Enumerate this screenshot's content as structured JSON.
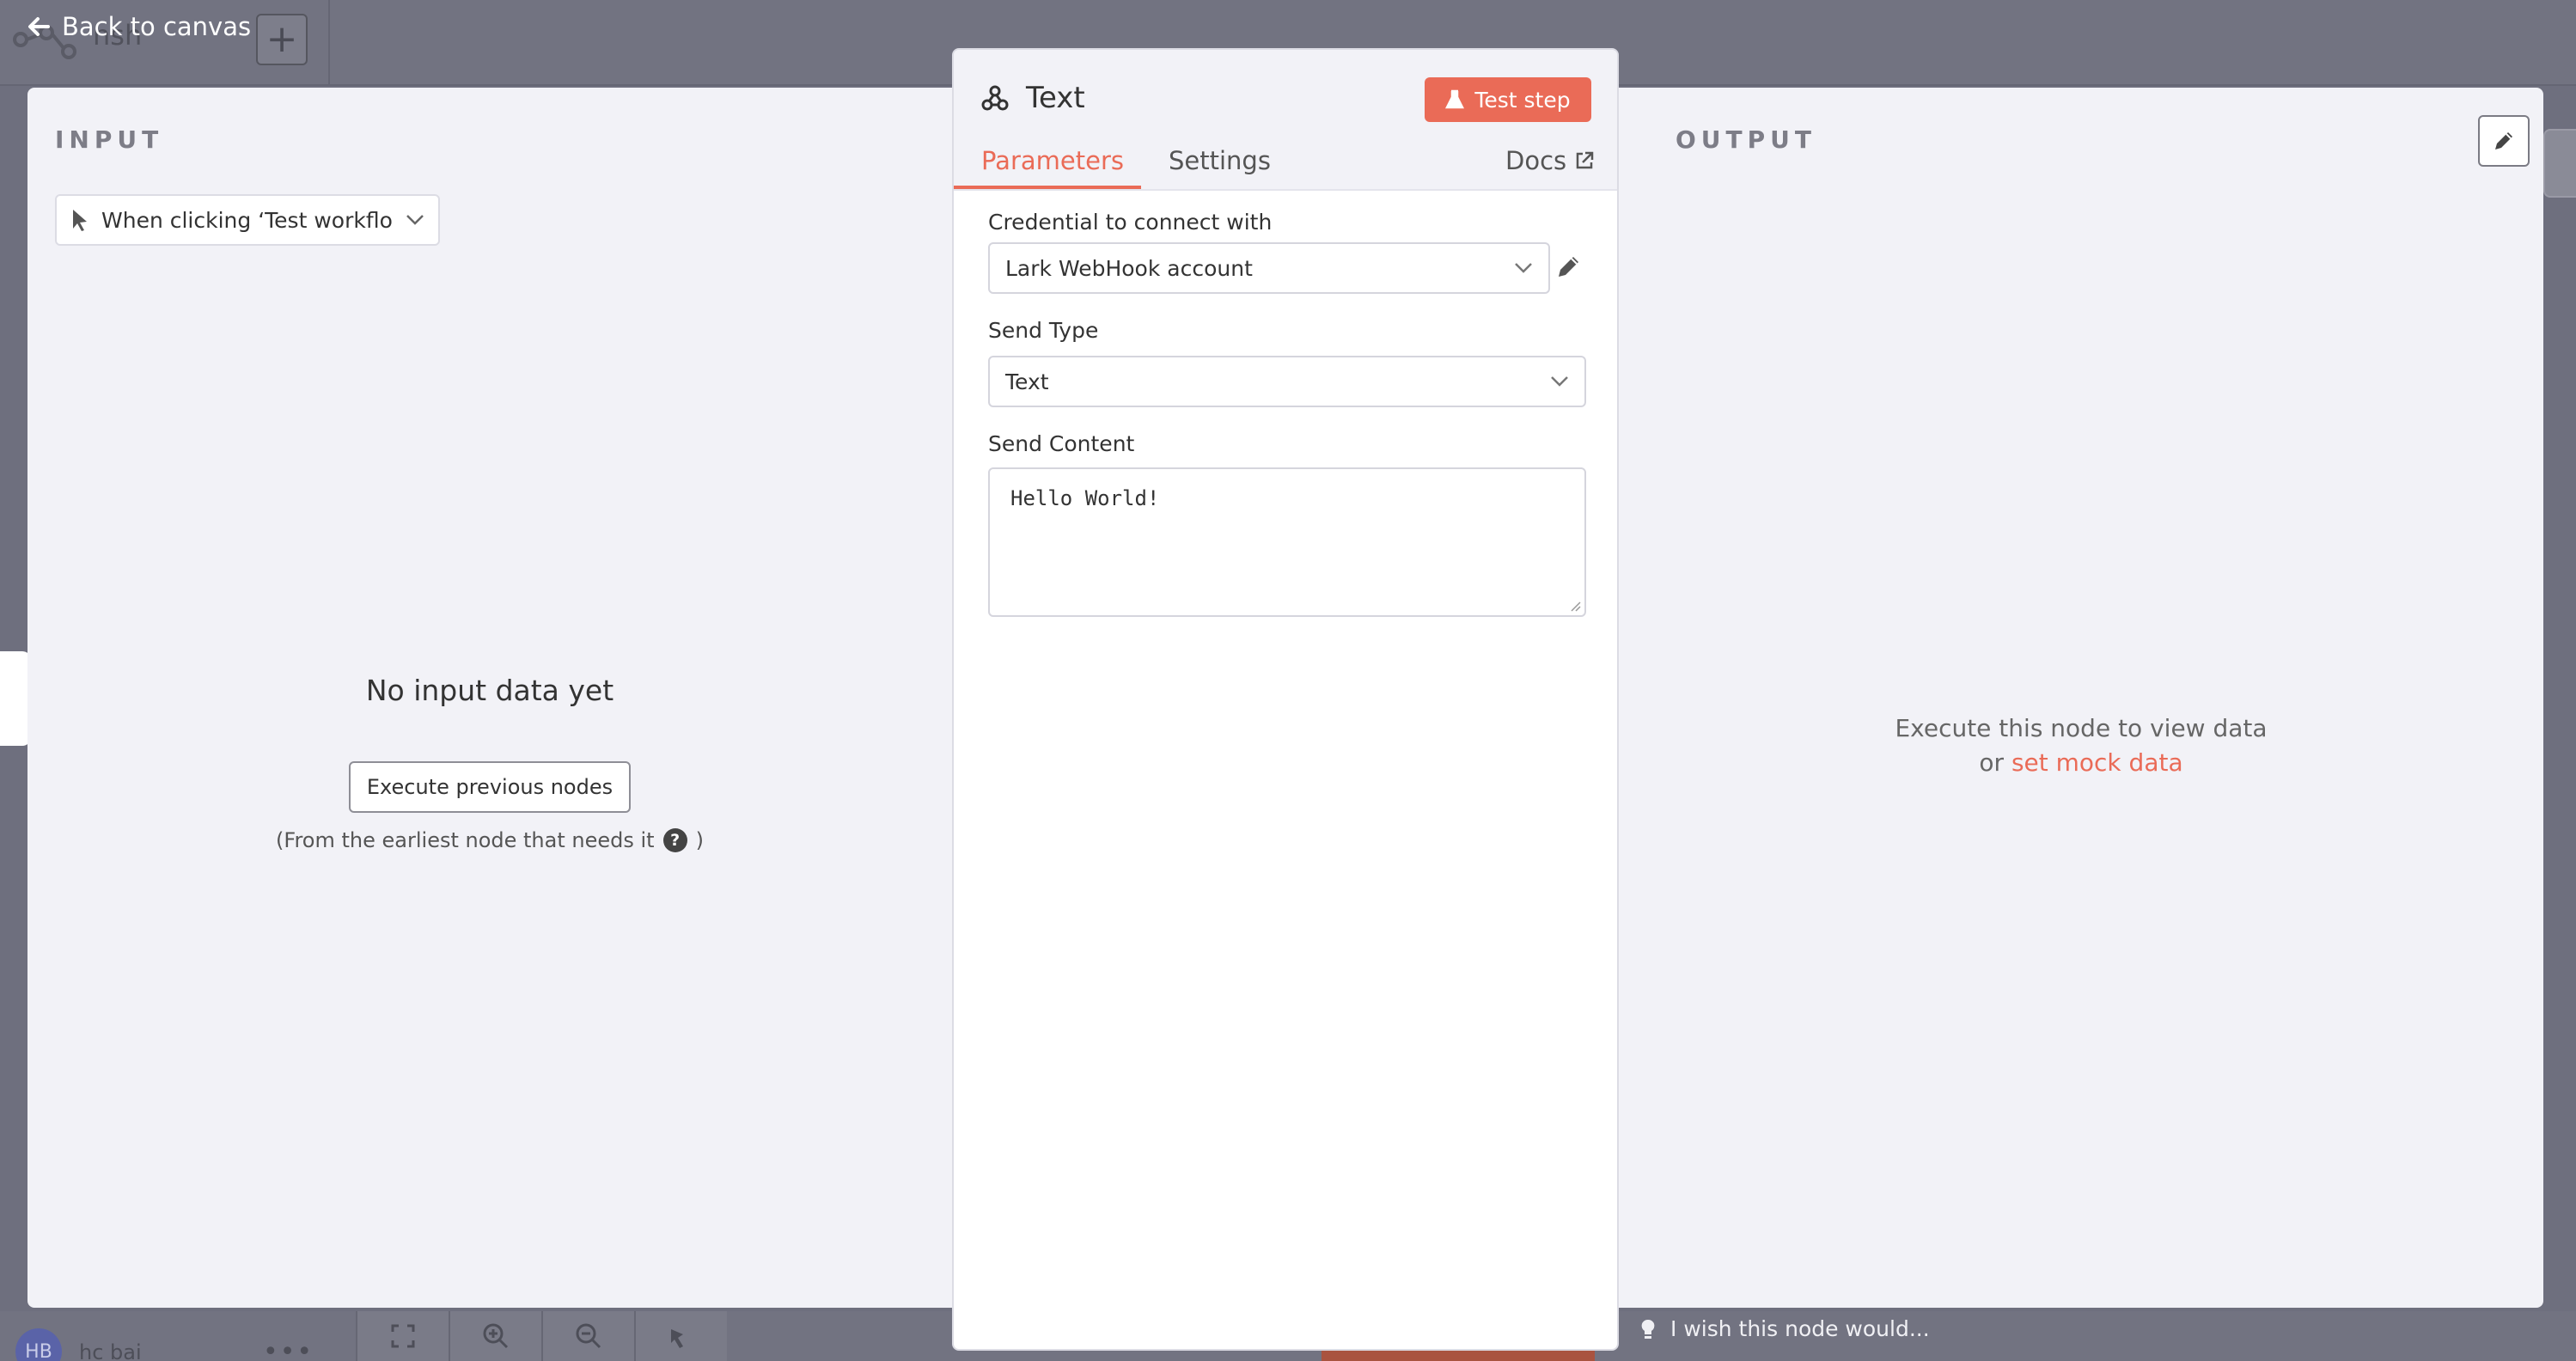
{
  "background": {
    "workflow_name": "nsh",
    "user_initials": "HB",
    "user_name": "hc bai",
    "more": "•••"
  },
  "nav": {
    "back_label": "Back to canvas"
  },
  "input_pane": {
    "label": "INPUT",
    "trigger": "When clicking ‘Test workflow’",
    "empty_title": "No input data yet",
    "execute_button": "Execute previous nodes",
    "hint_prefix": "(From the earliest node that needs it",
    "hint_suffix": ")"
  },
  "node": {
    "title": "Text",
    "test_button": "Test step",
    "tabs": [
      {
        "label": "Parameters",
        "active": true
      },
      {
        "label": "Settings",
        "active": false
      }
    ],
    "docs_label": "Docs",
    "fields": {
      "credential": {
        "label": "Credential to connect with",
        "value": "Lark WebHook account"
      },
      "send_type": {
        "label": "Send Type",
        "value": "Text"
      },
      "send_content": {
        "label": "Send Content",
        "value": "Hello World!"
      }
    },
    "feedback": "I wish this node would..."
  },
  "output_pane": {
    "label": "OUTPUT",
    "message_line1": "Execute this node to view data",
    "message_or": "or",
    "mock_link": "set mock data"
  },
  "colors": {
    "accent": "#ea6b57",
    "overlay": "#6e6f7e",
    "panel_bg": "#f2f2f7"
  }
}
